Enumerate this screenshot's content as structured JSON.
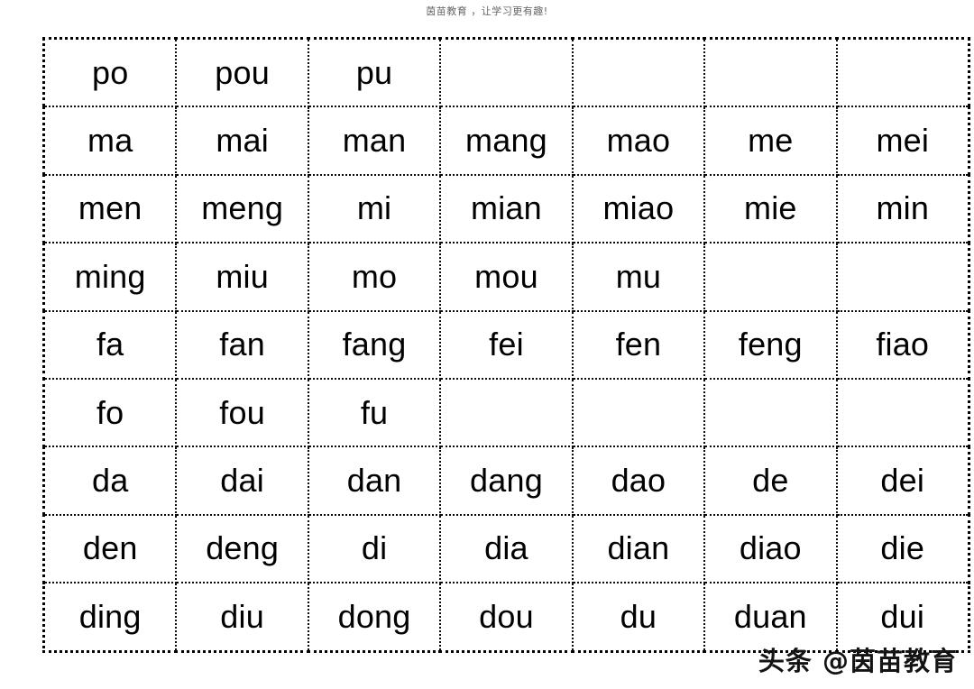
{
  "header": {
    "text": "茵苗教育 ，让学习更有趣!"
  },
  "watermark": {
    "text": "头条 @茵苗教育"
  },
  "table": {
    "columns": 7,
    "rows": 9,
    "border_style": "dotted",
    "border_color": "#000000",
    "text_color": "#000000",
    "background": "#ffffff",
    "cells": [
      [
        "po",
        "pou",
        "pu",
        "",
        "",
        "",
        ""
      ],
      [
        "ma",
        "mai",
        "man",
        "mang",
        "mao",
        "me",
        "mei"
      ],
      [
        "men",
        "meng",
        "mi",
        "mian",
        "miao",
        "mie",
        "min"
      ],
      [
        "ming",
        "miu",
        "mo",
        "mou",
        "mu",
        "",
        ""
      ],
      [
        "fa",
        "fan",
        "fang",
        "fei",
        "fen",
        "feng",
        "fiao"
      ],
      [
        "fo",
        "fou",
        "fu",
        "",
        "",
        "",
        ""
      ],
      [
        "da",
        "dai",
        "dan",
        "dang",
        "dao",
        "de",
        "dei"
      ],
      [
        "den",
        "deng",
        "di",
        "dia",
        "dian",
        "diao",
        "die"
      ],
      [
        "ding",
        "diu",
        "dong",
        "dou",
        "du",
        "duan",
        "dui"
      ]
    ]
  }
}
